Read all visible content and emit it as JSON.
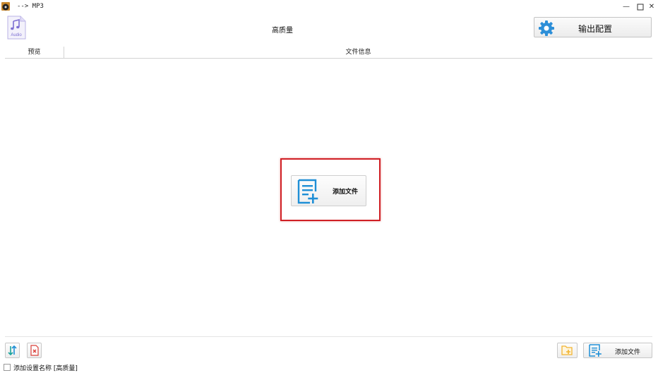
{
  "window": {
    "title": "--> MP3",
    "icons": {
      "app": "app-disc-icon",
      "minimize": "minimize-icon",
      "maximize": "maximize-icon",
      "close": "close-icon"
    }
  },
  "header": {
    "preset_icon": "audio-file-icon",
    "preset_icon_label": "Audio",
    "preset_name": "高质量",
    "output_config_label": "输出配置",
    "output_config_icon": "gear-icon"
  },
  "file_list": {
    "columns": [
      "预览",
      "文件信息"
    ],
    "empty_add_label": "添加文件",
    "empty_add_icon": "add-file-icon"
  },
  "toolbar": {
    "sort_icon": "sort-icon",
    "delete_icon": "delete-icon",
    "add_folder_icon": "add-folder-icon",
    "add_file_label": "添加文件",
    "add_file_icon": "add-file-icon"
  },
  "footer": {
    "checkbox_label": "添加设置名称 [高质量]",
    "checked": false
  },
  "colors": {
    "accent_blue": "#1f8fd6",
    "highlight_red": "#d01f25",
    "gear_blue": "#2d8fd8",
    "audio_purple": "#8a7fd6",
    "folder_yellow": "#f2b431"
  }
}
